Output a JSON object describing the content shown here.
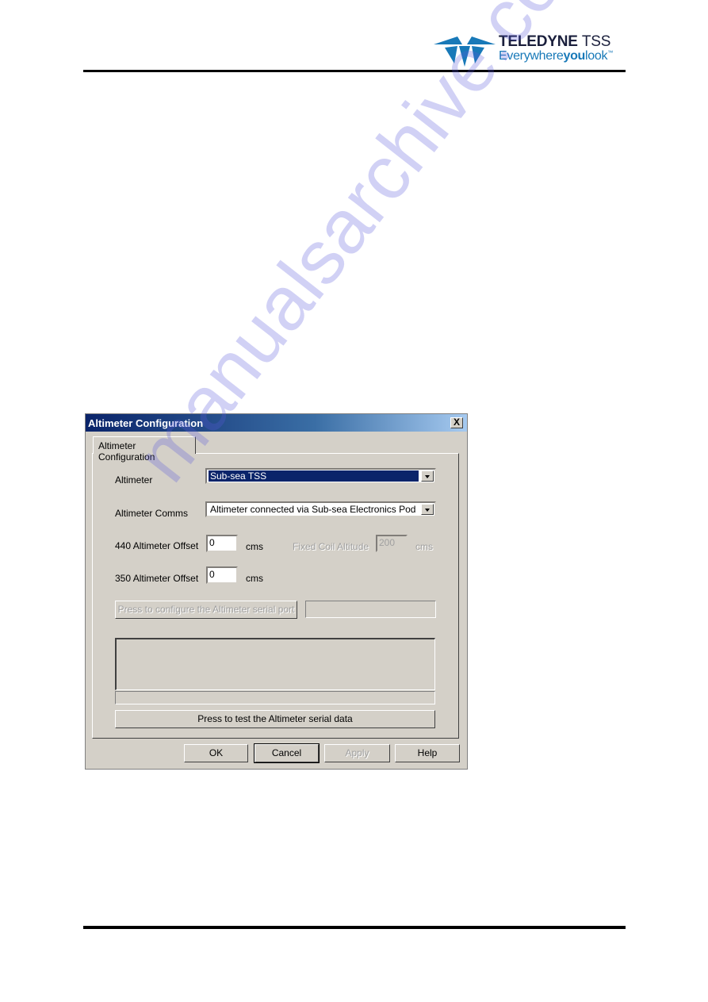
{
  "header": {
    "brand_name": "TELEDYNE",
    "brand_suffix": "TSS",
    "tagline_pre": "Everywhere",
    "tagline_bold": "you",
    "tagline_post": "look",
    "tagline_tm": "™",
    "brand_color": "#1879b8"
  },
  "dialog": {
    "title": "Altimeter Configuration",
    "close_label": "X",
    "tab_label": "Altimeter Configuration",
    "altimeter": {
      "label": "Altimeter",
      "value": "Sub-sea TSS"
    },
    "comms": {
      "label": "Altimeter Comms",
      "value": "Altimeter connected via Sub-sea Electronics Pod"
    },
    "offset_440": {
      "label": "440 Altimeter Offset",
      "value": "0",
      "unit": "cms"
    },
    "fixed_coil": {
      "label": "Fixed Coil Altitude",
      "value": "200",
      "unit": "cms"
    },
    "offset_350": {
      "label": "350 Altimeter Offset",
      "value": "0",
      "unit": "cms"
    },
    "configure_port_label": "Press to configure the Altimeter serial port",
    "port_status": "",
    "serial_output": "",
    "serial_status": "",
    "test_button_label": "Press to test the Altimeter serial data",
    "buttons": {
      "ok": "OK",
      "cancel": "Cancel",
      "apply": "Apply",
      "help": "Help"
    }
  },
  "watermark": "manualsarchive.com"
}
